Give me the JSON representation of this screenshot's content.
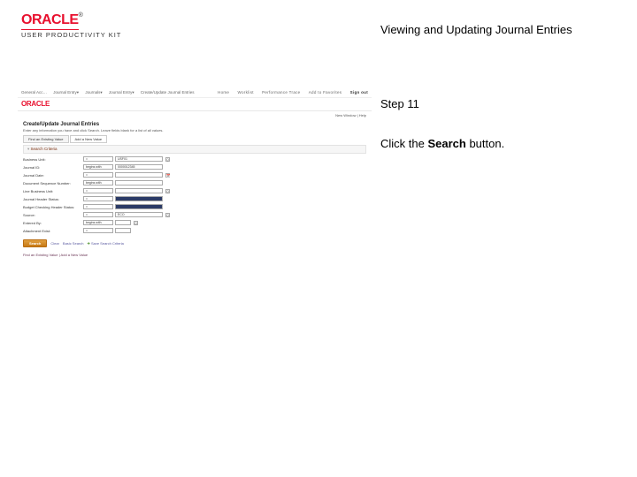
{
  "header": {
    "brand": "ORACLE",
    "tm": "®",
    "subtitle": "USER PRODUCTIVITY KIT"
  },
  "title": "Viewing and Updating Journal Entries",
  "instruction": {
    "step": "Step 11",
    "prefix": "Click the ",
    "bold": "Search",
    "suffix": " button."
  },
  "shot": {
    "crumbs": [
      "General Acc…",
      "Journal Entry▾",
      "Journals▾",
      "Journal Entry▾",
      "Create/Update Journal Entries"
    ],
    "tabs": [
      "Home",
      "Worklist",
      "Performance Trace",
      "Add to Favorites",
      "Sign out"
    ],
    "brand": "ORACLE",
    "util": "New Window | Help",
    "pageTitle": "Create/Update Journal Entries",
    "pageSub": "Enter any information you have and click Search. Leave fields blank for a list of all values.",
    "modeTabs": [
      "Find an Existing Value",
      "Add a New Value"
    ],
    "panel": "Search Criteria",
    "fields": [
      {
        "label": "Business Unit:",
        "sel": "=",
        "val": "USF01",
        "q": true
      },
      {
        "label": "Journal ID:",
        "sel": "begins with",
        "val": "0000012345"
      },
      {
        "label": "Journal Date:",
        "sel": "=",
        "val": "",
        "cal": true
      },
      {
        "label": "Document Sequence Number:",
        "sel": "begins with",
        "val": ""
      },
      {
        "label": "Line Business Unit:",
        "sel": "=",
        "val": "",
        "q": true
      },
      {
        "label": "Journal Header Status:",
        "sel": "=",
        "val": "",
        "blue": true
      },
      {
        "label": "Budget Checking Header Status:",
        "sel": "=",
        "val": "",
        "blue": true
      },
      {
        "label": "Source:",
        "sel": "=",
        "val": "ECO",
        "q": true
      },
      {
        "label": "Entered By:",
        "sel": "begins with",
        "val": "",
        "q": true
      },
      {
        "label": "Attachment Exist:",
        "sel": "=",
        "val": ""
      }
    ],
    "actions": {
      "search": "Search",
      "clear": "Clear",
      "basic": "Basic Search",
      "save": "Save Search Criteria"
    },
    "footer": "Find an Existing Value | Add a New Value"
  }
}
